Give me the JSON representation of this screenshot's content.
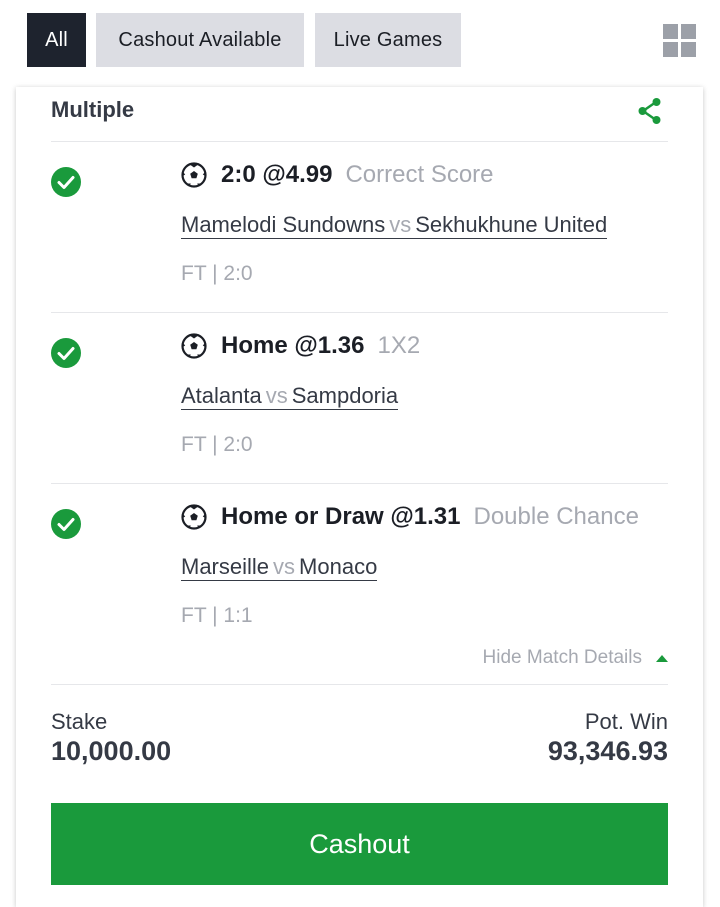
{
  "tabs": {
    "all": "All",
    "cashout_available": "Cashout Available",
    "live_games": "Live Games",
    "active": "all"
  },
  "card": {
    "title": "Multiple"
  },
  "selections": [
    {
      "pick": "2:0 @4.99",
      "market": "Correct Score",
      "home": "Mamelodi Sundowns",
      "vs": "vs",
      "away": "Sekhukhune United",
      "result": "FT | 2:0",
      "status": "won"
    },
    {
      "pick": "Home @1.36",
      "market": "1X2",
      "home": "Atalanta",
      "vs": "vs",
      "away": "Sampdoria",
      "result": "FT | 2:0",
      "status": "won"
    },
    {
      "pick": "Home or Draw @1.31",
      "market": "Double Chance",
      "home": "Marseille",
      "vs": "vs",
      "away": "Monaco",
      "result": "FT | 1:1",
      "status": "won"
    }
  ],
  "details_toggle": "Hide Match Details",
  "summary": {
    "stake_label": "Stake",
    "stake_value": "10,000.00",
    "pot_win_label": "Pot. Win",
    "pot_win_value": "93,346.93"
  },
  "cashout_label": "Cashout",
  "colors": {
    "accent_green": "#1a9a3c",
    "active_tab": "#1e232e",
    "inactive_tab": "#dcdde3",
    "muted_text": "#a6a9b1"
  },
  "icons": {
    "share": "share-icon",
    "check": "check-circle-icon",
    "sport": "soccer-ball-icon",
    "layout": "grid-view-icon",
    "collapse": "triangle-up-icon"
  }
}
